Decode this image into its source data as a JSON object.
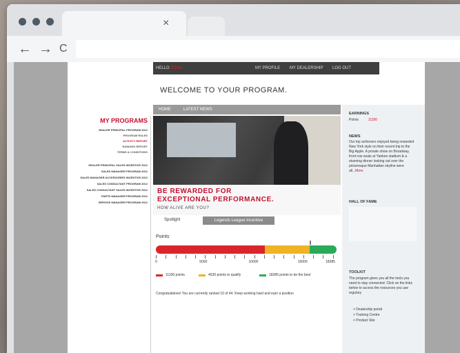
{
  "browser": {
    "tab_close": "×",
    "back_icon": "←",
    "forward_icon": "→",
    "reload_icon": "C"
  },
  "topbar": {
    "hello": "HELLO",
    "user": "JOHN",
    "nav": [
      "MY PROFILE",
      "MY DEALERSHIP",
      "LOG OUT"
    ]
  },
  "welcome": "WELCOME TO YOUR PROGRAM.",
  "subnav": [
    "HOME",
    "LATEST NEWS"
  ],
  "programs": {
    "title": "MY PROGRAMS",
    "items": [
      {
        "label": "DEALER PRINCIPAL PROGRAM 2012",
        "color": "#333333"
      },
      {
        "label": "PROGRAM RULES",
        "color": "#555555"
      },
      {
        "label": "ACTIVITY REPORT",
        "color": "#c41030"
      },
      {
        "label": "RANKING REPORT",
        "color": "#555555"
      },
      {
        "label": "TERMS & CONDITIONS",
        "color": "#555555"
      },
      {
        "label": "DEALER PRINCIPAL SALES INCENTIVE 2012",
        "color": "#333333"
      },
      {
        "label": "SALES MANAGER PROGRAM 2012",
        "color": "#333333"
      },
      {
        "label": "SALES MANAGER ACCESSORIES INCENTIVE 2012",
        "color": "#333333"
      },
      {
        "label": "SALES CONSULTANT PROGRAM 2012",
        "color": "#333333"
      },
      {
        "label": "SALES CONSULTANT SALES INCENTIVE 2012",
        "color": "#333333"
      },
      {
        "label": "PARTS MANAGER PROGRAM 2012",
        "color": "#333333"
      },
      {
        "label": "SERVICE MANAGER PROGRAM 2012",
        "color": "#333333"
      }
    ]
  },
  "hero": {
    "line1": "BE REWARDED FOR",
    "line2": "EXCEPTIONAL PERFORMANCE.",
    "line3": "HOW ALIVE ARE YOU?"
  },
  "tabs": {
    "spotlight": "Spotlight",
    "legends": "Legends League Incentive"
  },
  "points": {
    "label": "Points",
    "ticks": [
      "0",
      "5000",
      "10000",
      "15000",
      "18385"
    ],
    "max": 18385,
    "current": 11100,
    "qualify": 15630,
    "best": 18385,
    "colors": {
      "red": "#d9262a",
      "yellow": "#f0b323",
      "green": "#2aab59"
    },
    "legend": [
      "11100 points",
      "4530 points to qualify",
      "18385 points to be the best"
    ],
    "congrats": "Congratulations! You are currently ranked 10 of 44. Keep working hard and earn a position"
  },
  "right": {
    "earnings_title": "EARNINGS",
    "earnings_label": "Points",
    "earnings_value": "11100",
    "news_title": "NEWS",
    "news_text": "Our top achievers enjoyed being rewarded New York style on their recent trip to the Big Apple. A private show on Broadway, front row seats at Yankee stadium & a stunning dinner looking out over the picturesque Manhattan skyline were all...",
    "news_more": "More",
    "hof_title": "HALL OF FAME",
    "toolkit_title": "TOOLKIT",
    "toolkit_text": "The program gives you all the tools you need to stay connected. Click on the links below to access the resources you use regulary",
    "links": [
      "> Dealership portal",
      "> Training Centre",
      "> Product Site"
    ]
  }
}
